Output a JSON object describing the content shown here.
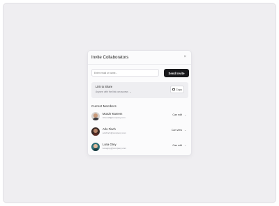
{
  "dialog": {
    "title": "Invite Collaborators",
    "close_icon": "×"
  },
  "invite": {
    "placeholder": "Enter email or name...",
    "send_label": "Send Invite"
  },
  "share": {
    "label": "Link to Share",
    "access": "Anyone with the link can access",
    "copy_label": "Copy"
  },
  "members": {
    "title": "Current Members",
    "items": [
      {
        "name": "Munzir Kareem",
        "email": "Uhexa8@company.com",
        "role": "Can edit"
      },
      {
        "name": "Arlo Finch",
        "email": "arlofinch@company.com",
        "role": "Can view"
      },
      {
        "name": "Luna Grey",
        "email": "lunagrey@company.com",
        "role": "Can edit"
      }
    ]
  },
  "colors": {
    "background": "#efeef1",
    "card": "#fbfbfc",
    "primary_button": "#18181b"
  }
}
